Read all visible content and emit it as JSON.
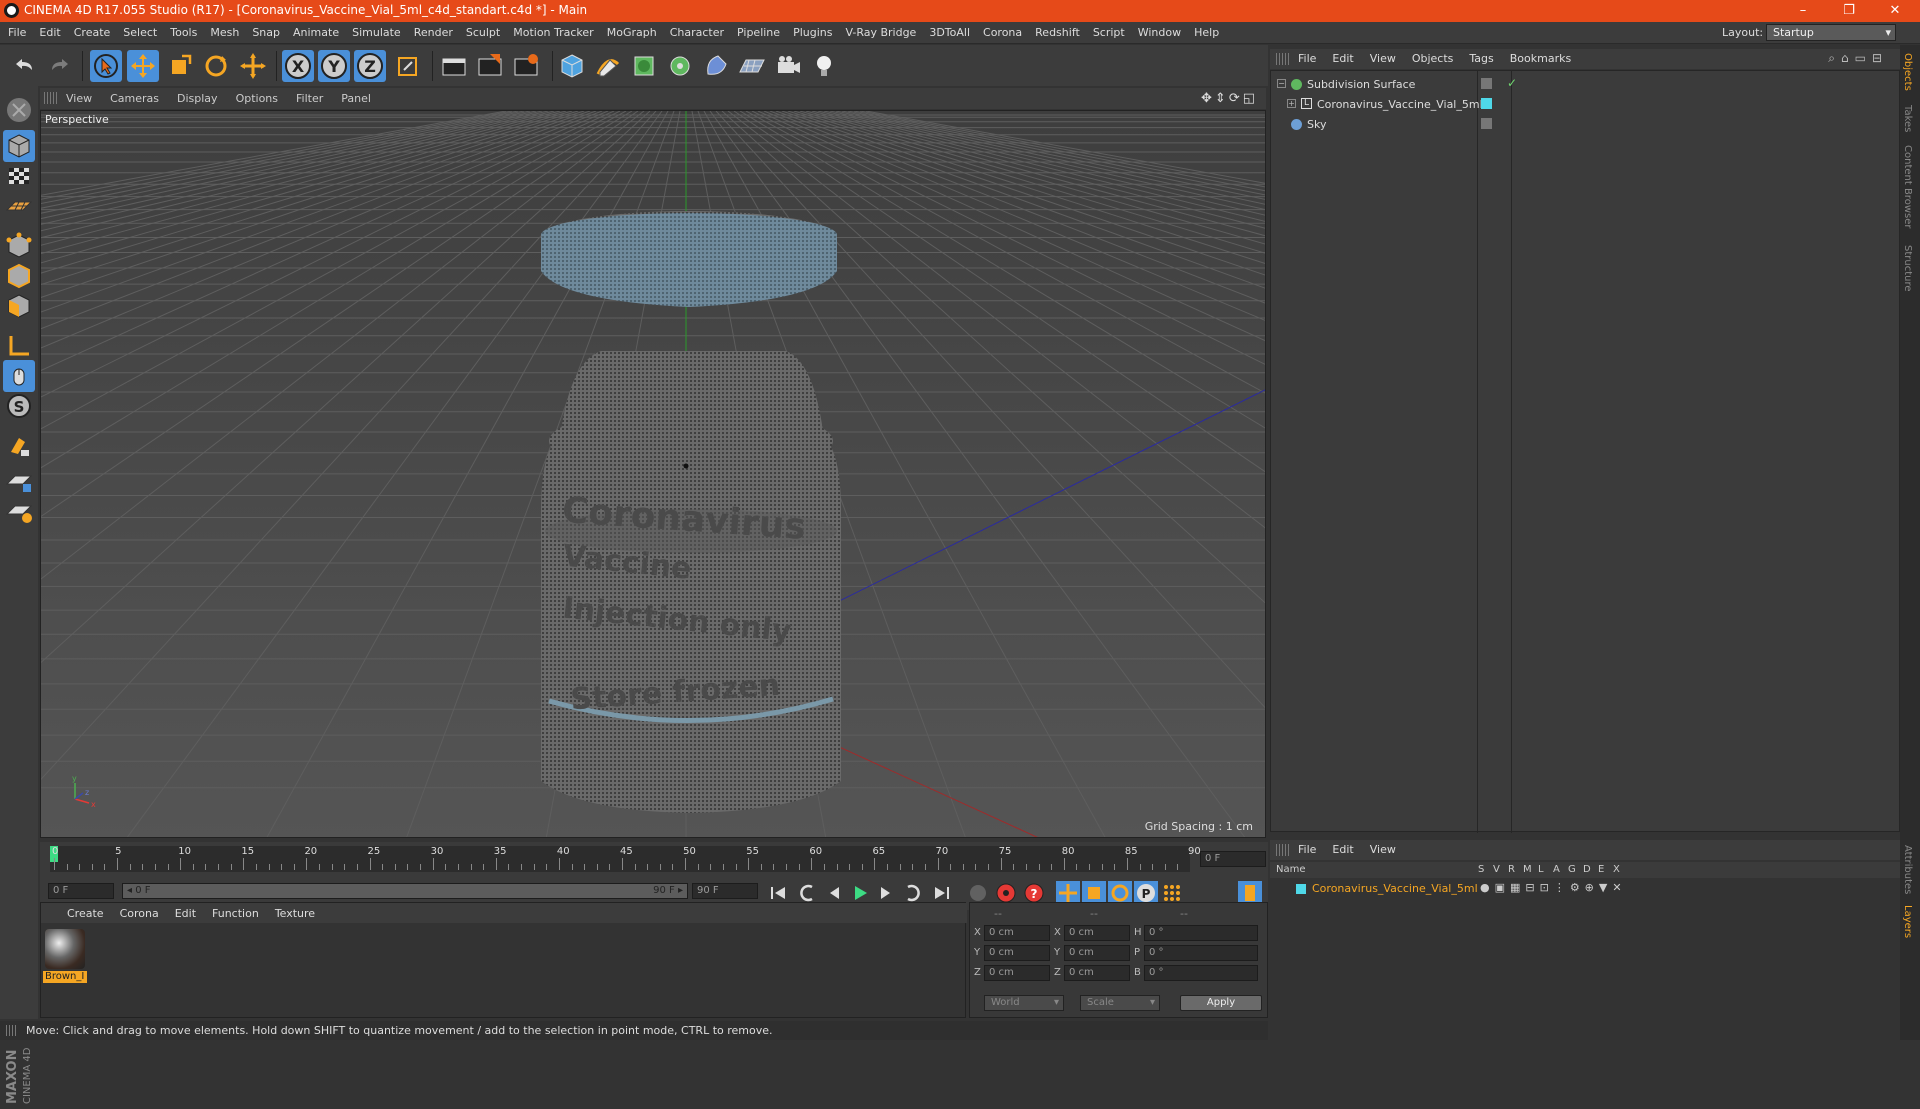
{
  "window": {
    "title": "CINEMA 4D R17.055 Studio (R17) - [Coronavirus_Vaccine_Vial_5ml_c4d_standart.c4d *] - Main",
    "controls": [
      "–",
      "❐",
      "✕"
    ]
  },
  "menubar": {
    "items": [
      "File",
      "Edit",
      "Create",
      "Select",
      "Tools",
      "Mesh",
      "Snap",
      "Animate",
      "Simulate",
      "Render",
      "Sculpt",
      "Motion Tracker",
      "MoGraph",
      "Character",
      "Pipeline",
      "Plugins",
      "V-Ray Bridge",
      "3DToAll",
      "Corona",
      "Redshift",
      "Script",
      "Window",
      "Help"
    ],
    "layout_label": "Layout:",
    "layout_value": "Startup"
  },
  "viewport": {
    "menu": [
      "View",
      "Cameras",
      "Display",
      "Options",
      "Filter",
      "Panel"
    ],
    "label": "Perspective",
    "grid_spacing": "Grid Spacing : 1 cm"
  },
  "timeline": {
    "ticks": [
      "0",
      "5",
      "10",
      "15",
      "20",
      "25",
      "30",
      "35",
      "40",
      "45",
      "50",
      "55",
      "60",
      "65",
      "70",
      "75",
      "80",
      "85",
      "90"
    ],
    "current_frame": "0 F",
    "start_field": "0 F",
    "range_start": "◂ 0 F",
    "range_end": "90 F ▸",
    "end_field": "90 F"
  },
  "material_panel": {
    "menu": [
      "Create",
      "Corona",
      "Edit",
      "Function",
      "Texture"
    ],
    "materials": [
      {
        "name": "Brown_I"
      }
    ]
  },
  "coord_panel": {
    "headers": [
      "--",
      "--",
      "--"
    ],
    "rows": [
      {
        "a_label": "X",
        "a_val": "0 cm",
        "b_label": "X",
        "b_val": "0 cm",
        "c_label": "H",
        "c_val": "0 °"
      },
      {
        "a_label": "Y",
        "a_val": "0 cm",
        "b_label": "Y",
        "b_val": "0 cm",
        "c_label": "P",
        "c_val": "0 °"
      },
      {
        "a_label": "Z",
        "a_val": "0 cm",
        "b_label": "Z",
        "b_val": "0 cm",
        "c_label": "B",
        "c_val": "0 °"
      }
    ],
    "world_select": "World",
    "scale_select": "Scale",
    "apply_label": "Apply"
  },
  "status": {
    "text": "Move: Click and drag to move elements. Hold down SHIFT to quantize movement / add to the selection in point mode, CTRL to remove."
  },
  "objects_panel": {
    "menu": [
      "File",
      "Edit",
      "View",
      "Objects",
      "Tags",
      "Bookmarks"
    ],
    "objects": [
      {
        "name": "Subdivision Surface",
        "color": "#5fb85f"
      },
      {
        "name": "Coronavirus_Vaccine_Vial_5ml",
        "color": "#4fc3f7"
      },
      {
        "name": "Sky",
        "color": "#6d9fd6"
      }
    ]
  },
  "layers_panel": {
    "menu": [
      "File",
      "Edit",
      "View"
    ],
    "columns": [
      "Name",
      "S",
      "V",
      "R",
      "M",
      "L",
      "A",
      "G",
      "D",
      "E",
      "X"
    ],
    "rows": [
      {
        "name": "Coronavirus_Vaccine_Vial_5ml",
        "color": "#4fd8e8"
      }
    ]
  },
  "side_tabs": [
    "Objects",
    "Takes",
    "Content Browser",
    "Structure",
    "Attributes",
    "Layers"
  ],
  "vial_label": [
    "Coronavirus",
    "Vaccine",
    "Injection only",
    "Store frozen"
  ],
  "maxon_brand": "MAXON CINEMA 4D",
  "colors": {
    "accent": "#e64a19",
    "active_tool": "#4a90d9",
    "selection": "#f5a623"
  }
}
